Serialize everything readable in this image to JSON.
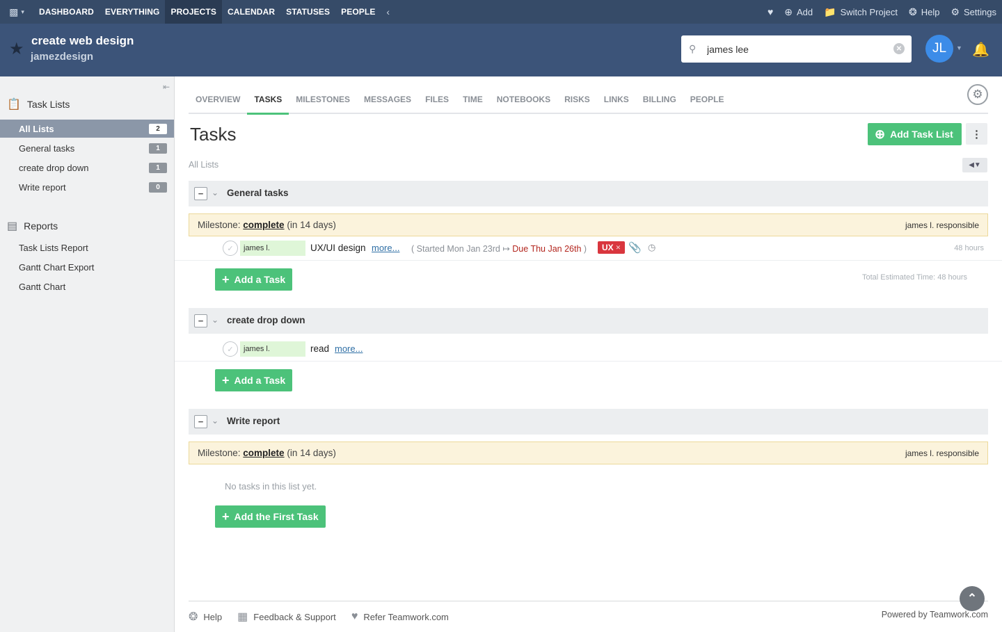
{
  "topnav": {
    "items": [
      "DASHBOARD",
      "EVERYTHING",
      "PROJECTS",
      "CALENDAR",
      "STATUSES",
      "PEOPLE"
    ],
    "active": "PROJECTS",
    "right": {
      "add": "Add",
      "switch_project": "Switch Project",
      "help": "Help",
      "settings": "Settings"
    }
  },
  "project": {
    "title": "create web design",
    "company": "jamezdesign"
  },
  "search": {
    "value": "james lee",
    "placeholder": ""
  },
  "user": {
    "initials": "JL"
  },
  "sidebar": {
    "task_lists_heading": "Task Lists",
    "lists": [
      {
        "label": "All Lists",
        "count": "2"
      },
      {
        "label": "General tasks",
        "count": "1"
      },
      {
        "label": "create drop down",
        "count": "1"
      },
      {
        "label": "Write report",
        "count": "0"
      }
    ],
    "reports_heading": "Reports",
    "reports": [
      "Task Lists Report",
      "Gantt Chart Export",
      "Gantt Chart"
    ]
  },
  "tabs": [
    "OVERVIEW",
    "TASKS",
    "MILESTONES",
    "MESSAGES",
    "FILES",
    "TIME",
    "NOTEBOOKS",
    "RISKS",
    "LINKS",
    "BILLING",
    "PEOPLE"
  ],
  "main": {
    "title": "Tasks",
    "add_task_list": "Add Task List",
    "breadcrumb": "All Lists",
    "task_lists": [
      {
        "name": "General tasks",
        "milestone": {
          "prefix": "Milestone:",
          "link": "complete",
          "suffix": "(in 14 days)",
          "responsible": "james l. responsible"
        },
        "tasks": [
          {
            "assignee": "james l.",
            "name": "UX/UI design",
            "more": "more...",
            "dates_start": "( Started Mon Jan 23rd ↦ ",
            "dates_due": "Due Thu Jan 26th",
            "dates_end": " )",
            "tag": "UX",
            "hours": "48 hours"
          }
        ],
        "add_button": "Add a Task",
        "total": "Total Estimated Time: 48 hours"
      },
      {
        "name": "create drop down",
        "tasks": [
          {
            "assignee": "james l.",
            "name": "read",
            "more": "more..."
          }
        ],
        "add_button": "Add a Task"
      },
      {
        "name": "Write report",
        "milestone": {
          "prefix": "Milestone:",
          "link": "complete",
          "suffix": "(in 14 days)",
          "responsible": "james l. responsible"
        },
        "empty": "No tasks in this list yet.",
        "add_button": "Add the First Task"
      }
    ]
  },
  "footer": {
    "help": "Help",
    "feedback": "Feedback & Support",
    "refer": "Refer Teamwork.com",
    "powered": "Powered by Teamwork.com"
  },
  "colors": {
    "topbar": "#364b68",
    "header": "#3c5479",
    "accent": "#4cc27a",
    "tag_red": "#d9363e"
  }
}
